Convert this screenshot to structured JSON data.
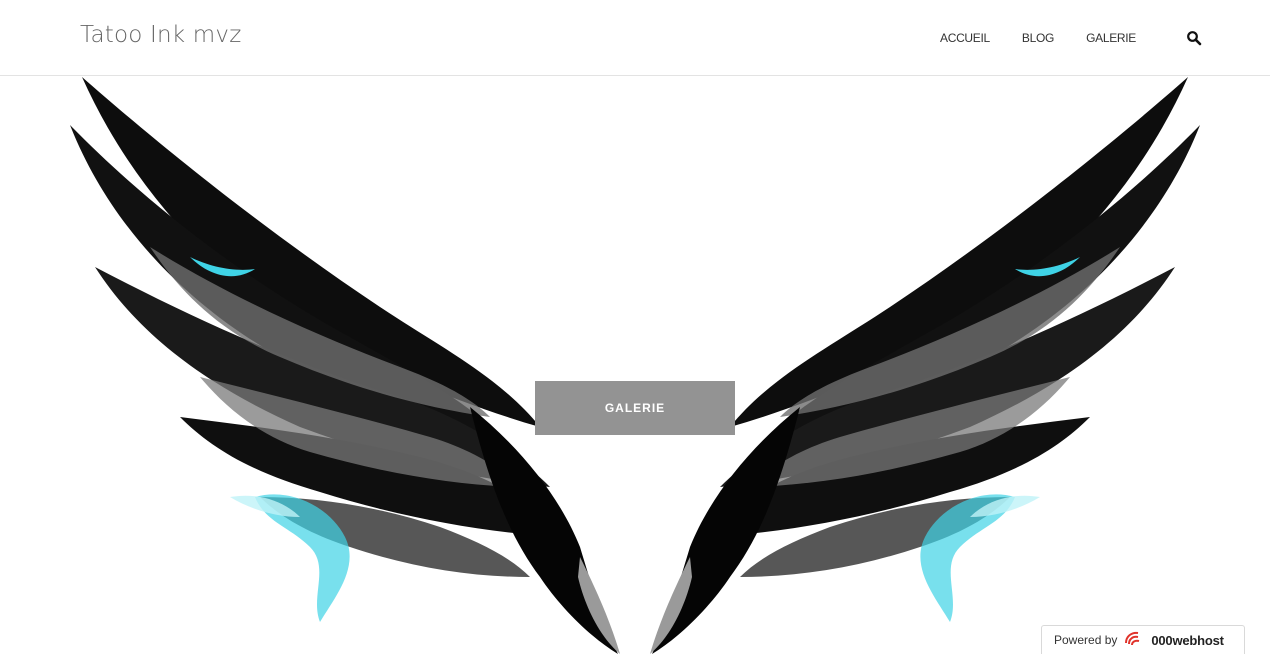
{
  "site": {
    "title": "Tatoo Ink mvz"
  },
  "nav": {
    "items": [
      {
        "label": "ACCUEIL"
      },
      {
        "label": "BLOG"
      },
      {
        "label": "GALERIE"
      }
    ],
    "search_icon": "search-icon"
  },
  "hero": {
    "image": "black-wings-illustration",
    "button_label": "GALERIE",
    "colors": {
      "feather_black": "#0d0d0d",
      "feather_grey": "#6e6e6e",
      "accent_cyan": "#3fd3e6",
      "button_bg": "#939393"
    }
  },
  "footer_badge": {
    "powered_by": "Powered by",
    "host": "000webhost",
    "logo_icon": "000webhost-logo-icon"
  }
}
